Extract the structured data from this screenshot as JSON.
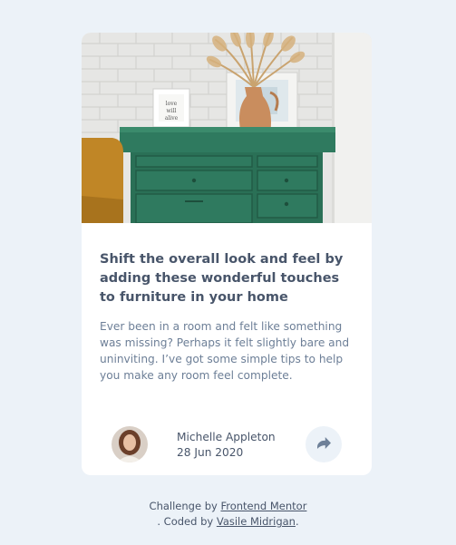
{
  "article": {
    "title": "Shift the overall look and feel by adding these wonderful touches to furniture in your home",
    "description": "Ever been in a room and felt like something was missing? Perhaps it felt slightly bare and uninviting. I’ve got some simple tips to help you make any room feel complete."
  },
  "author": {
    "name": "Michelle Appleton",
    "date": "28 Jun 2020"
  },
  "share": {
    "icon": "share-icon"
  },
  "attribution": {
    "prefix": "Challenge by ",
    "challenge_link": "Frontend Mentor",
    "middle": ". Coded by ",
    "coder_link": "Vasile Midrigan",
    "suffix": "."
  },
  "colors": {
    "background": "#ecf2f8",
    "card": "#ffffff",
    "heading": "#48556a",
    "body_text": "#6d7f97",
    "dresser_green": "#2f7a5f"
  }
}
